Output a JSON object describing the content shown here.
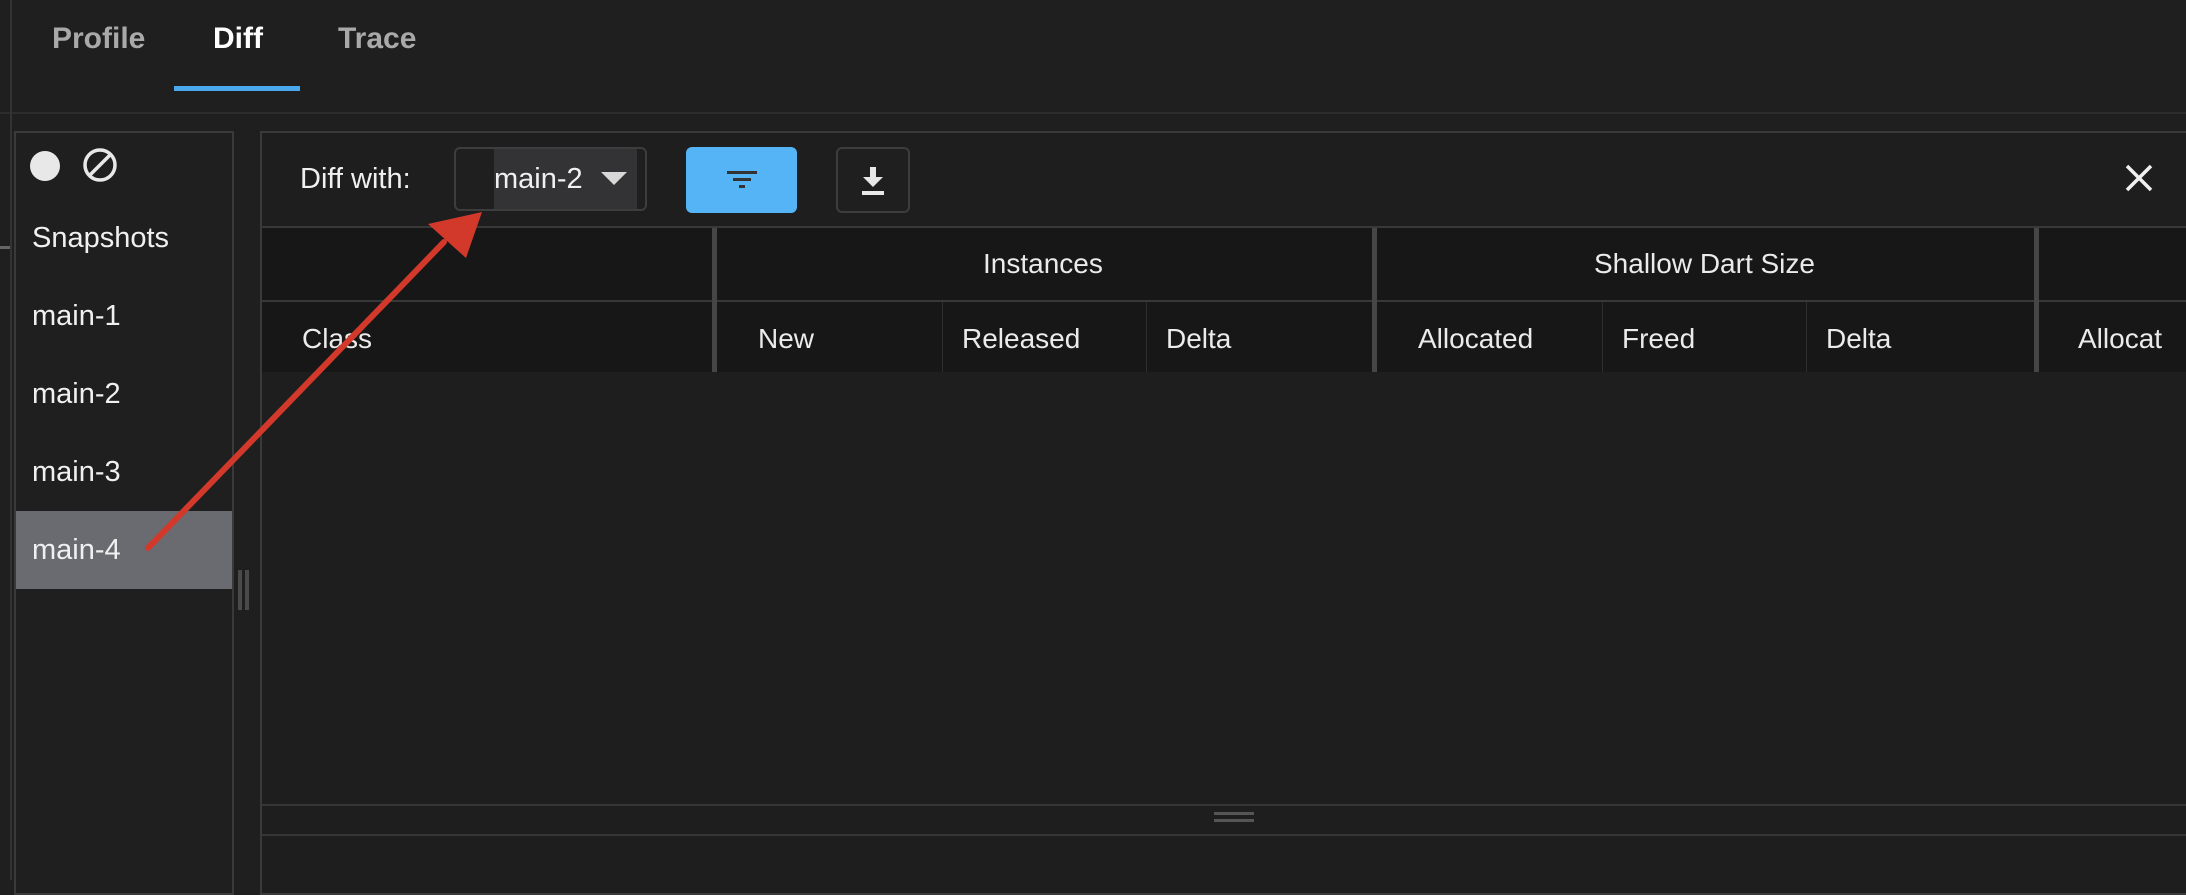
{
  "tabs": {
    "profile": "Profile",
    "diff": "Diff",
    "trace": "Trace"
  },
  "snapshots": {
    "header": "Snapshots",
    "items": [
      "main-1",
      "main-2",
      "main-3",
      "main-4"
    ],
    "selected": "main-4"
  },
  "toolbar": {
    "diff_with_label": "Diff with:",
    "diff_with_value": "main-2"
  },
  "table": {
    "group_headers": [
      "Instances",
      "Shallow Dart Size"
    ],
    "column_headers": [
      "Class",
      "New",
      "Released",
      "Delta",
      "Allocated",
      "Freed",
      "Delta",
      "Allocat"
    ]
  },
  "colors": {
    "accent": "#49a9ec",
    "filter_button": "#54b4f5",
    "annotation_arrow": "#d2392b",
    "selected_row": "#696b70"
  }
}
